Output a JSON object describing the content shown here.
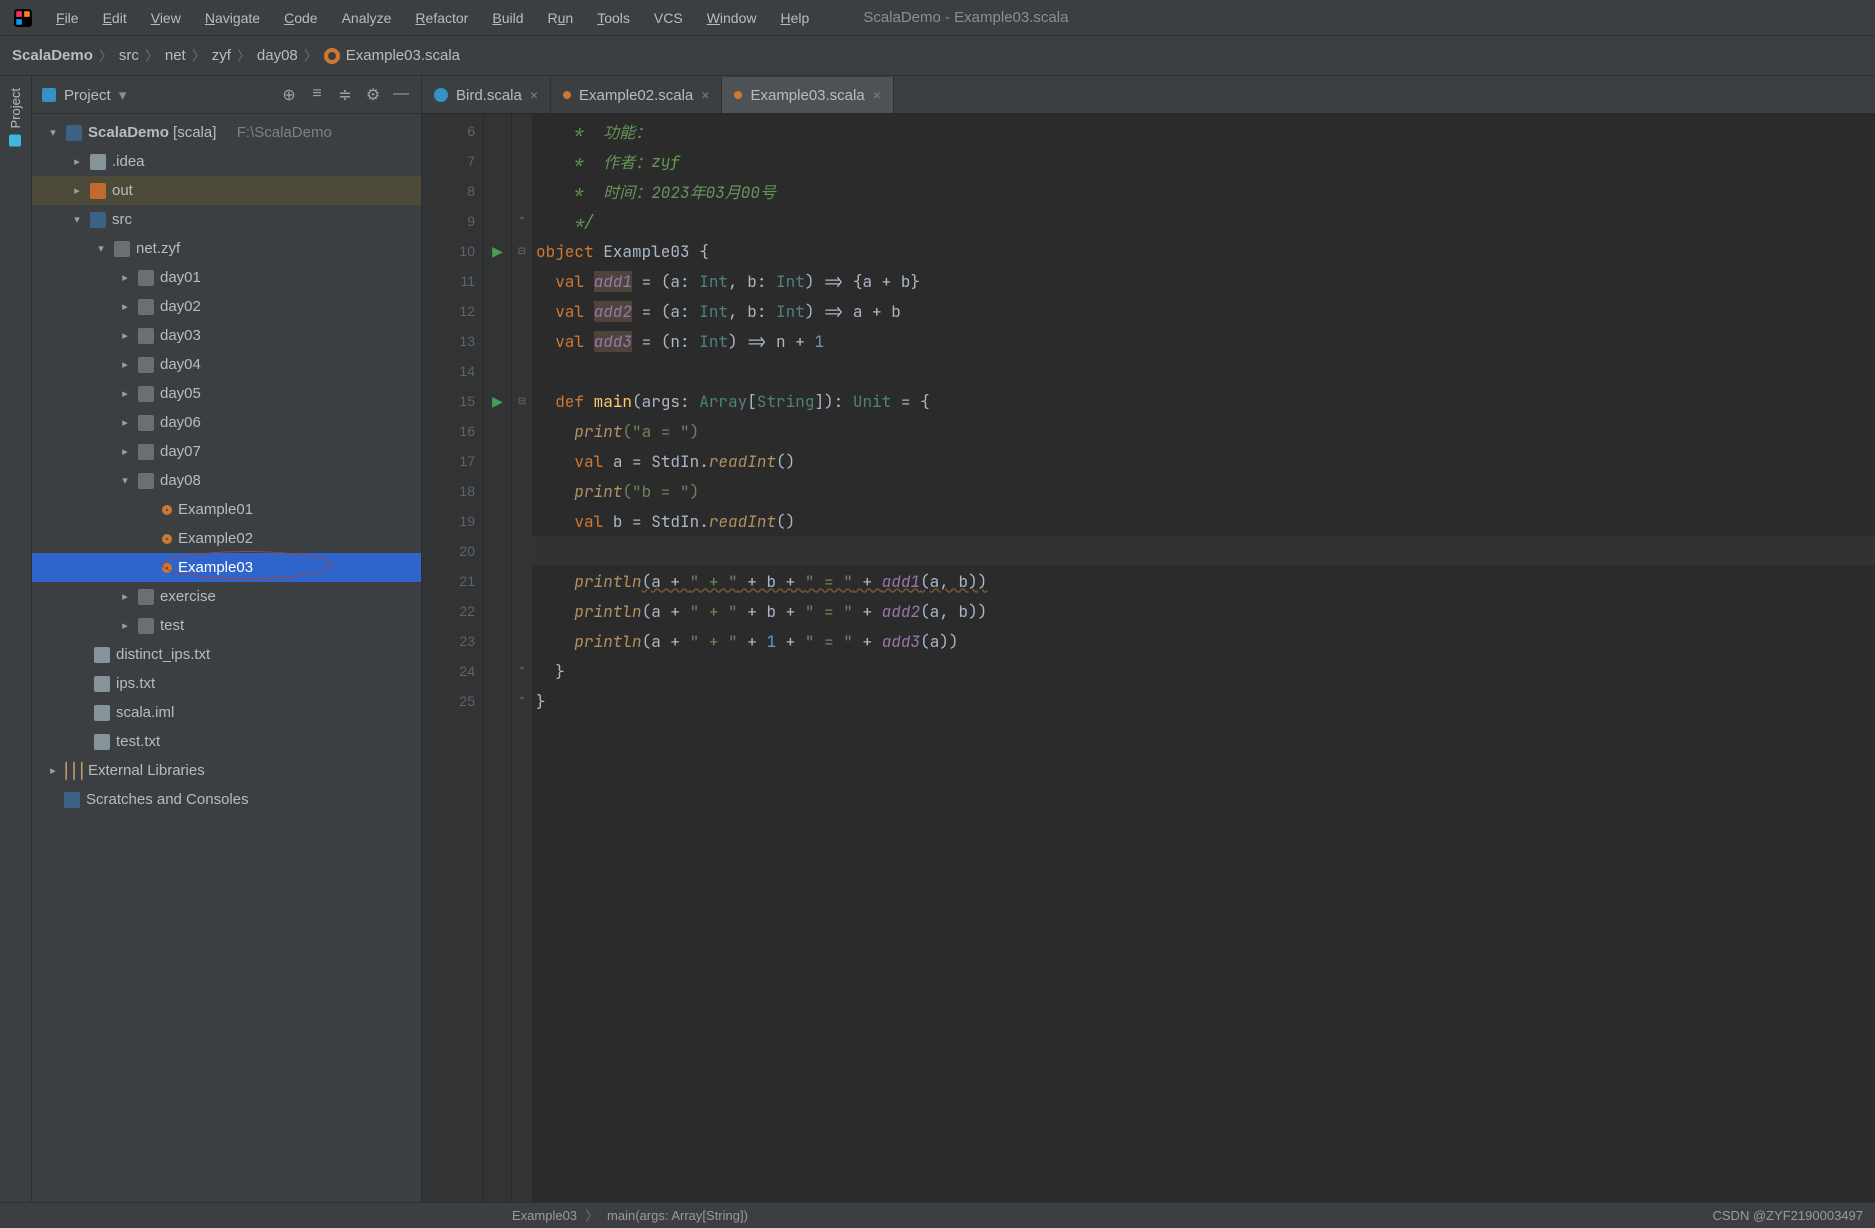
{
  "window_title": "ScalaDemo - Example03.scala",
  "menu": {
    "file": "File",
    "edit": "Edit",
    "view": "View",
    "navigate": "Navigate",
    "code": "Code",
    "analyze": "Analyze",
    "refactor": "Refactor",
    "build": "Build",
    "run": "Run",
    "tools": "Tools",
    "vcs": "VCS",
    "window": "Window",
    "help": "Help"
  },
  "breadcrumb": {
    "project": "ScalaDemo",
    "p1": "src",
    "p2": "net",
    "p3": "zyf",
    "p4": "day08",
    "file": "Example03.scala"
  },
  "tree": {
    "header": "Project",
    "root": {
      "name": "ScalaDemo",
      "tag": "[scala]",
      "path": "F:\\ScalaDemo"
    },
    "idea": ".idea",
    "out": "out",
    "src": "src",
    "pkg": "net.zyf",
    "day01": "day01",
    "day02": "day02",
    "day03": "day03",
    "day04": "day04",
    "day05": "day05",
    "day06": "day06",
    "day07": "day07",
    "day08": "day08",
    "ex1": "Example01",
    "ex2": "Example02",
    "ex3": "Example03",
    "exercise": "exercise",
    "test": "test",
    "f1": "distinct_ips.txt",
    "f2": "ips.txt",
    "f3": "scala.iml",
    "f4": "test.txt",
    "ext": "External Libraries",
    "scratch": "Scratches and Consoles"
  },
  "tabs": {
    "t1": "Bird.scala",
    "t2": "Example02.scala",
    "t3": "Example03.scala"
  },
  "gutter_start": 6,
  "code": {
    "l6": "    *  功能：",
    "l7a": "    *  作者：",
    "l7b": "zyf",
    "l8a": "    *  时间：",
    "l8b": "2023年03月00号",
    "l9": "    */",
    "l10_kw": "object",
    "l10_nm": " Example03 {",
    "l11_kw": "  val ",
    "l11_hl": "add1",
    "l11_rest_a": " = (a: ",
    "l11_t1": "Int",
    "l11_rest_b": ", b: ",
    "l11_t2": "Int",
    "l11_rest_c": ") => {a + b}",
    "l12_kw": "  val ",
    "l12_hl": "add2",
    "l12_rest_a": " = (a: ",
    "l12_t1": "Int",
    "l12_rest_b": ", b: ",
    "l12_t2": "Int",
    "l12_rest_c": ") => a + b",
    "l13_kw": "  val ",
    "l13_hl": "add3",
    "l13_rest_a": " = (n: ",
    "l13_t1": "Int",
    "l13_rest_b": ") => n + ",
    "l13_num": "1",
    "l15_kw": "  def ",
    "l15_fn": "main",
    "l15_a": "(args: ",
    "l15_t1": "Array",
    "l15_b": "[",
    "l15_t2": "String",
    "l15_c": "]): ",
    "l15_t3": "Unit",
    "l15_d": " = {",
    "l16_fn": "    print",
    "l16_s": "(\"a = \")",
    "l17_kw": "    val ",
    "l17_a": "a = StdIn.",
    "l17_fn": "readInt",
    "l17_b": "()",
    "l18_fn": "    print",
    "l18_s": "(\"b = \")",
    "l19_kw": "    val ",
    "l19_a": "b = StdIn.",
    "l19_fn": "readInt",
    "l19_b": "()",
    "l21_fn": "    println",
    "l21_a": "(a + ",
    "l21_s1": "\" + \"",
    "l21_b": " + b + ",
    "l21_s2": "\" = \"",
    "l21_c": " + ",
    "l21_it": "add1",
    "l21_d": "(a, b))",
    "l22_fn": "    println",
    "l22_a": "(a + ",
    "l22_s1": "\" + \"",
    "l22_b": " + b + ",
    "l22_s2": "\" = \"",
    "l22_c": " + ",
    "l22_it": "add2",
    "l22_d": "(a, b))",
    "l23_fn": "    println",
    "l23_a": "(a + ",
    "l23_s1": "\" + \"",
    "l23_b": " + ",
    "l23_num": "1",
    "l23_c": " + ",
    "l23_s2": "\" = \"",
    "l23_d": " + ",
    "l23_it": "add3",
    "l23_e": "(a))",
    "l24": "  }",
    "l25": "}"
  },
  "gutter": {
    "n6": "6",
    "n7": "7",
    "n8": "8",
    "n9": "9",
    "n10": "10",
    "n11": "11",
    "n12": "12",
    "n13": "13",
    "n14": "14",
    "n15": "15",
    "n16": "16",
    "n17": "17",
    "n18": "18",
    "n19": "19",
    "n20": "20",
    "n21": "21",
    "n22": "22",
    "n23": "23",
    "n24": "24",
    "n25": "25"
  },
  "status": {
    "nav1": "Example03",
    "nav2": "main(args: Array[String])",
    "watermark": "CSDN @ZYF2190003497"
  }
}
